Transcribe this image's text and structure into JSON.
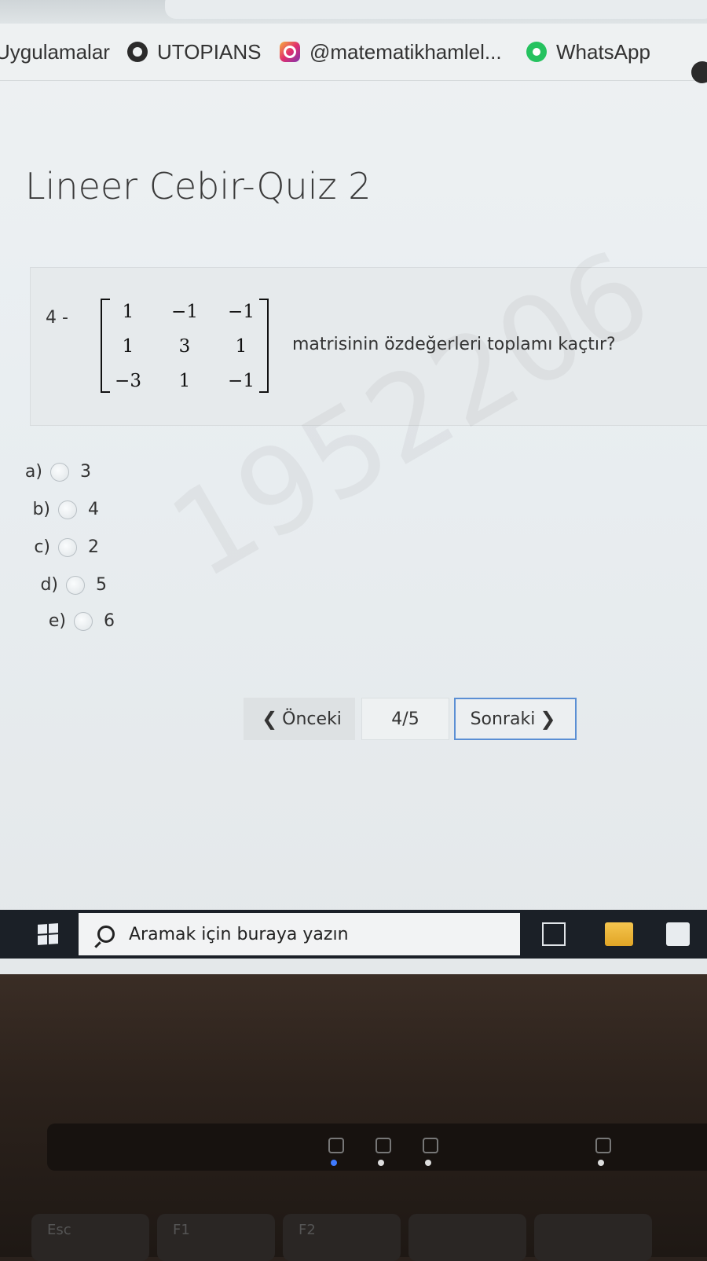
{
  "bookmarks": [
    {
      "label": "Uygulamalar",
      "icon": "apps-icon"
    },
    {
      "label": "UTOPIANS",
      "icon": "globe-icon"
    },
    {
      "label": "@matematikhamlel...",
      "icon": "instagram-icon"
    },
    {
      "label": "WhatsApp",
      "icon": "whatsapp-icon"
    }
  ],
  "quiz": {
    "title": "Lineer Cebir-Quiz 2",
    "question_number": "4 -",
    "matrix": [
      [
        "1",
        "−1",
        "−1"
      ],
      [
        "1",
        "3",
        "1"
      ],
      [
        "−3",
        "1",
        "−1"
      ]
    ],
    "question_text": "matrisinin özdeğerleri toplamı kaçtır?",
    "options": [
      {
        "label": "a)",
        "value": "3"
      },
      {
        "label": "b)",
        "value": "4"
      },
      {
        "label": "c)",
        "value": "2"
      },
      {
        "label": "d)",
        "value": "5"
      },
      {
        "label": "e)",
        "value": "6"
      }
    ],
    "watermark": "1952206"
  },
  "nav": {
    "prev_label": "Önceki",
    "page_indicator": "4/5",
    "next_label": "Sonraki"
  },
  "taskbar": {
    "search_placeholder": "Aramak için buraya yazın"
  },
  "keyboard": {
    "keys": [
      "Esc",
      "F1",
      "F2"
    ]
  }
}
